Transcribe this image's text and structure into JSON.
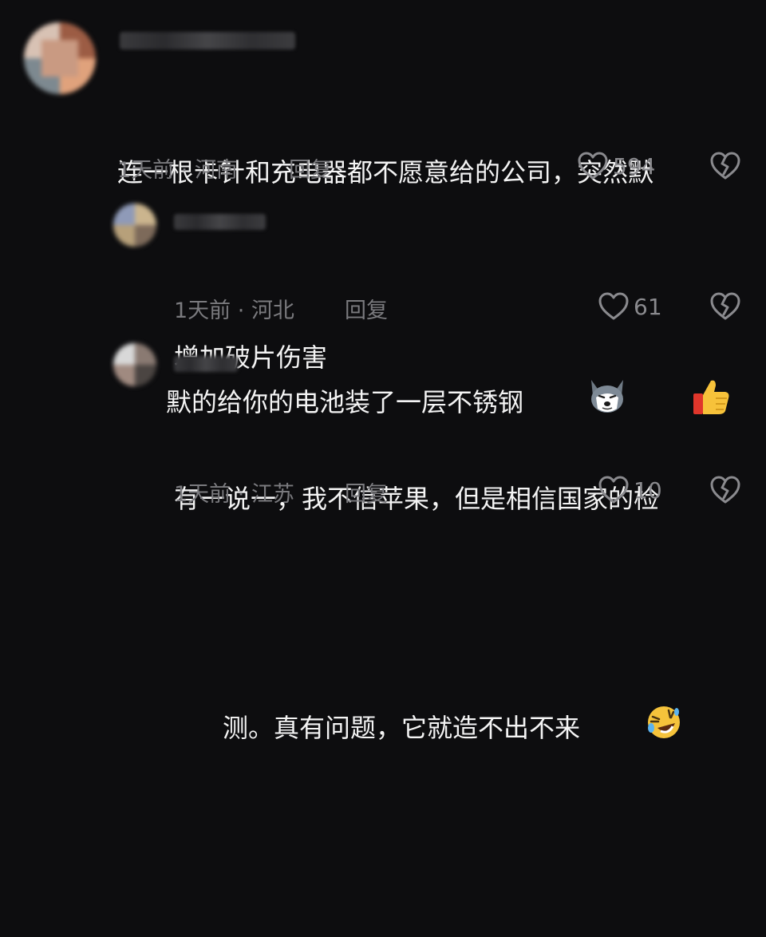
{
  "comments": [
    {
      "text_line1": "连一根卡针和充电器都不愿意给的公司，突然默",
      "text_line2": "默的给你的电池装了一层不锈钢",
      "emojis": [
        "husky-dog-emoji",
        "thumbs-up-emoji"
      ],
      "time": "1天前",
      "location": "河南",
      "reply_label": "回复",
      "likes": "594"
    },
    {
      "text_line1": "增加破片伤害",
      "time": "1天前",
      "location": "河北",
      "reply_label": "回复",
      "likes": "61"
    },
    {
      "text_line1": "有一说一，我不信苹果，但是相信国家的检",
      "text_line2": "测。真有问题，它就造不出不来",
      "emojis": [
        "rolling-laughing-emoji"
      ],
      "time": "1天前",
      "location": "江苏",
      "reply_label": "回复",
      "likes": "10"
    }
  ],
  "meta_separator": " · ",
  "colors": {
    "background": "#0d0d0f",
    "text": "#f4f4f4",
    "muted": "#7a7a7e"
  }
}
